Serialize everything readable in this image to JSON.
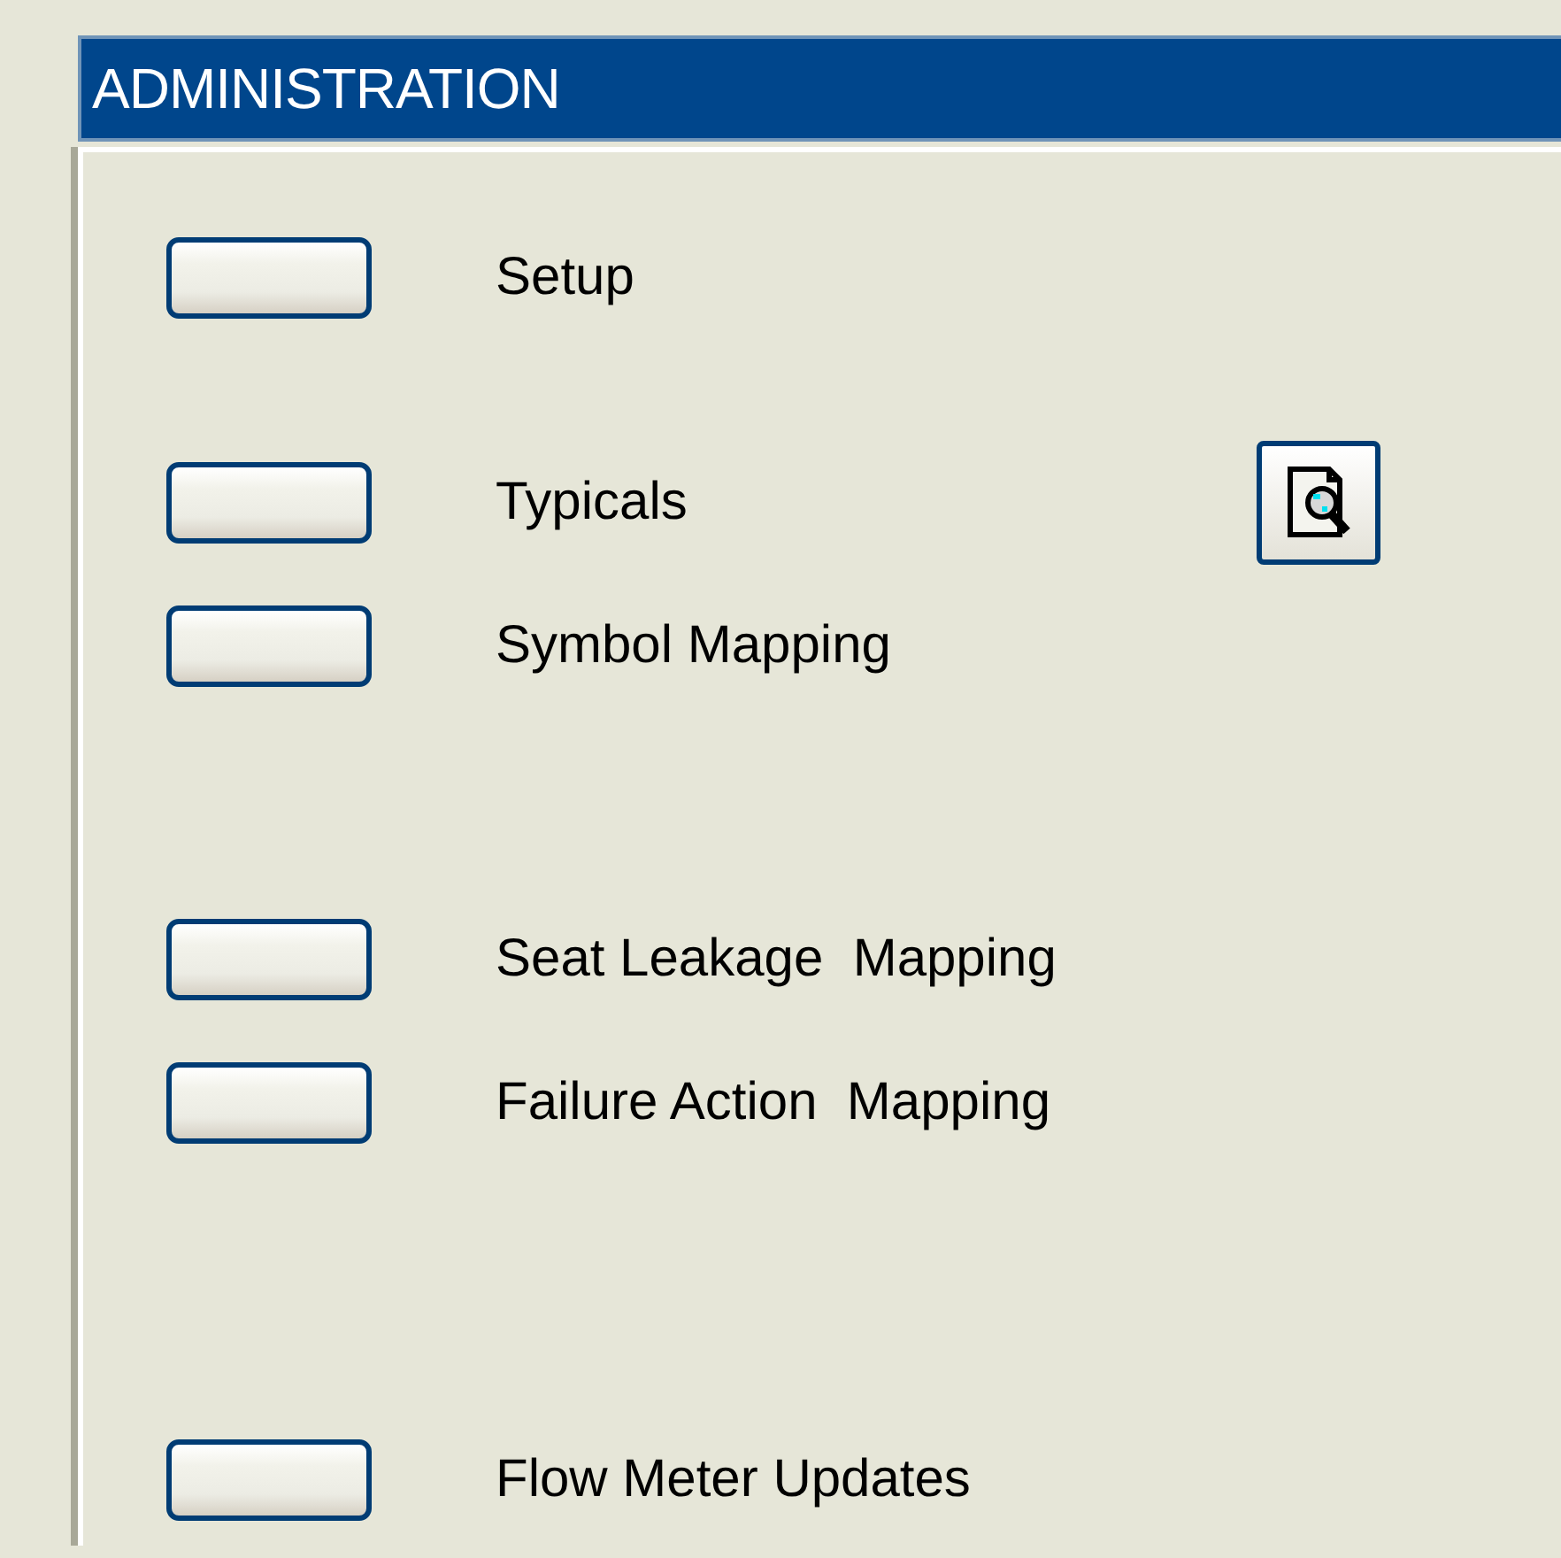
{
  "header": {
    "title": "ADMINISTRATION"
  },
  "groups": [
    {
      "items": [
        {
          "label": "Setup",
          "kind": "plain"
        }
      ]
    },
    {
      "items": [
        {
          "label": "Typicals",
          "kind": "preview"
        },
        {
          "label": "Symbol Mapping",
          "kind": "plain"
        }
      ]
    },
    {
      "items": [
        {
          "label": "Seat Leakage  Mapping",
          "kind": "plain"
        },
        {
          "label": "Failure Action  Mapping",
          "kind": "plain"
        }
      ]
    },
    {
      "items": [
        {
          "label": "Flow Meter Updates",
          "kind": "plain"
        }
      ]
    }
  ]
}
